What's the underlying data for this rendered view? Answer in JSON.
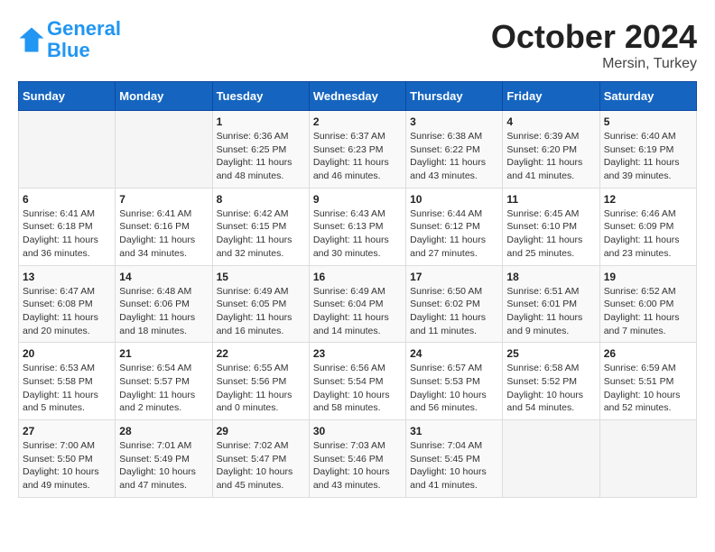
{
  "header": {
    "logo_line1": "General",
    "logo_line2": "Blue",
    "month": "October 2024",
    "location": "Mersin, Turkey"
  },
  "days_of_week": [
    "Sunday",
    "Monday",
    "Tuesday",
    "Wednesday",
    "Thursday",
    "Friday",
    "Saturday"
  ],
  "weeks": [
    [
      {
        "num": "",
        "sunrise": "",
        "sunset": "",
        "daylight": ""
      },
      {
        "num": "",
        "sunrise": "",
        "sunset": "",
        "daylight": ""
      },
      {
        "num": "1",
        "sunrise": "Sunrise: 6:36 AM",
        "sunset": "Sunset: 6:25 PM",
        "daylight": "Daylight: 11 hours and 48 minutes."
      },
      {
        "num": "2",
        "sunrise": "Sunrise: 6:37 AM",
        "sunset": "Sunset: 6:23 PM",
        "daylight": "Daylight: 11 hours and 46 minutes."
      },
      {
        "num": "3",
        "sunrise": "Sunrise: 6:38 AM",
        "sunset": "Sunset: 6:22 PM",
        "daylight": "Daylight: 11 hours and 43 minutes."
      },
      {
        "num": "4",
        "sunrise": "Sunrise: 6:39 AM",
        "sunset": "Sunset: 6:20 PM",
        "daylight": "Daylight: 11 hours and 41 minutes."
      },
      {
        "num": "5",
        "sunrise": "Sunrise: 6:40 AM",
        "sunset": "Sunset: 6:19 PM",
        "daylight": "Daylight: 11 hours and 39 minutes."
      }
    ],
    [
      {
        "num": "6",
        "sunrise": "Sunrise: 6:41 AM",
        "sunset": "Sunset: 6:18 PM",
        "daylight": "Daylight: 11 hours and 36 minutes."
      },
      {
        "num": "7",
        "sunrise": "Sunrise: 6:41 AM",
        "sunset": "Sunset: 6:16 PM",
        "daylight": "Daylight: 11 hours and 34 minutes."
      },
      {
        "num": "8",
        "sunrise": "Sunrise: 6:42 AM",
        "sunset": "Sunset: 6:15 PM",
        "daylight": "Daylight: 11 hours and 32 minutes."
      },
      {
        "num": "9",
        "sunrise": "Sunrise: 6:43 AM",
        "sunset": "Sunset: 6:13 PM",
        "daylight": "Daylight: 11 hours and 30 minutes."
      },
      {
        "num": "10",
        "sunrise": "Sunrise: 6:44 AM",
        "sunset": "Sunset: 6:12 PM",
        "daylight": "Daylight: 11 hours and 27 minutes."
      },
      {
        "num": "11",
        "sunrise": "Sunrise: 6:45 AM",
        "sunset": "Sunset: 6:10 PM",
        "daylight": "Daylight: 11 hours and 25 minutes."
      },
      {
        "num": "12",
        "sunrise": "Sunrise: 6:46 AM",
        "sunset": "Sunset: 6:09 PM",
        "daylight": "Daylight: 11 hours and 23 minutes."
      }
    ],
    [
      {
        "num": "13",
        "sunrise": "Sunrise: 6:47 AM",
        "sunset": "Sunset: 6:08 PM",
        "daylight": "Daylight: 11 hours and 20 minutes."
      },
      {
        "num": "14",
        "sunrise": "Sunrise: 6:48 AM",
        "sunset": "Sunset: 6:06 PM",
        "daylight": "Daylight: 11 hours and 18 minutes."
      },
      {
        "num": "15",
        "sunrise": "Sunrise: 6:49 AM",
        "sunset": "Sunset: 6:05 PM",
        "daylight": "Daylight: 11 hours and 16 minutes."
      },
      {
        "num": "16",
        "sunrise": "Sunrise: 6:49 AM",
        "sunset": "Sunset: 6:04 PM",
        "daylight": "Daylight: 11 hours and 14 minutes."
      },
      {
        "num": "17",
        "sunrise": "Sunrise: 6:50 AM",
        "sunset": "Sunset: 6:02 PM",
        "daylight": "Daylight: 11 hours and 11 minutes."
      },
      {
        "num": "18",
        "sunrise": "Sunrise: 6:51 AM",
        "sunset": "Sunset: 6:01 PM",
        "daylight": "Daylight: 11 hours and 9 minutes."
      },
      {
        "num": "19",
        "sunrise": "Sunrise: 6:52 AM",
        "sunset": "Sunset: 6:00 PM",
        "daylight": "Daylight: 11 hours and 7 minutes."
      }
    ],
    [
      {
        "num": "20",
        "sunrise": "Sunrise: 6:53 AM",
        "sunset": "Sunset: 5:58 PM",
        "daylight": "Daylight: 11 hours and 5 minutes."
      },
      {
        "num": "21",
        "sunrise": "Sunrise: 6:54 AM",
        "sunset": "Sunset: 5:57 PM",
        "daylight": "Daylight: 11 hours and 2 minutes."
      },
      {
        "num": "22",
        "sunrise": "Sunrise: 6:55 AM",
        "sunset": "Sunset: 5:56 PM",
        "daylight": "Daylight: 11 hours and 0 minutes."
      },
      {
        "num": "23",
        "sunrise": "Sunrise: 6:56 AM",
        "sunset": "Sunset: 5:54 PM",
        "daylight": "Daylight: 10 hours and 58 minutes."
      },
      {
        "num": "24",
        "sunrise": "Sunrise: 6:57 AM",
        "sunset": "Sunset: 5:53 PM",
        "daylight": "Daylight: 10 hours and 56 minutes."
      },
      {
        "num": "25",
        "sunrise": "Sunrise: 6:58 AM",
        "sunset": "Sunset: 5:52 PM",
        "daylight": "Daylight: 10 hours and 54 minutes."
      },
      {
        "num": "26",
        "sunrise": "Sunrise: 6:59 AM",
        "sunset": "Sunset: 5:51 PM",
        "daylight": "Daylight: 10 hours and 52 minutes."
      }
    ],
    [
      {
        "num": "27",
        "sunrise": "Sunrise: 7:00 AM",
        "sunset": "Sunset: 5:50 PM",
        "daylight": "Daylight: 10 hours and 49 minutes."
      },
      {
        "num": "28",
        "sunrise": "Sunrise: 7:01 AM",
        "sunset": "Sunset: 5:49 PM",
        "daylight": "Daylight: 10 hours and 47 minutes."
      },
      {
        "num": "29",
        "sunrise": "Sunrise: 7:02 AM",
        "sunset": "Sunset: 5:47 PM",
        "daylight": "Daylight: 10 hours and 45 minutes."
      },
      {
        "num": "30",
        "sunrise": "Sunrise: 7:03 AM",
        "sunset": "Sunset: 5:46 PM",
        "daylight": "Daylight: 10 hours and 43 minutes."
      },
      {
        "num": "31",
        "sunrise": "Sunrise: 7:04 AM",
        "sunset": "Sunset: 5:45 PM",
        "daylight": "Daylight: 10 hours and 41 minutes."
      },
      {
        "num": "",
        "sunrise": "",
        "sunset": "",
        "daylight": ""
      },
      {
        "num": "",
        "sunrise": "",
        "sunset": "",
        "daylight": ""
      }
    ]
  ]
}
